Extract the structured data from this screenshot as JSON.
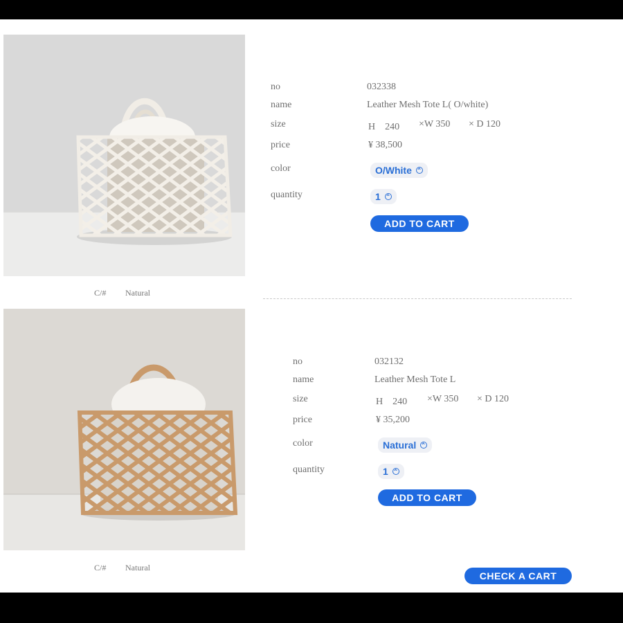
{
  "products": [
    {
      "no_label": "no",
      "no": "032338",
      "name_label": "name",
      "name": "Leather Mesh Tote L( O/white)",
      "size_label": "size",
      "size_h": "H　240",
      "size_w": "×W 350",
      "size_d": "× D 120",
      "price_label": "price",
      "price": "¥ 38,500",
      "color_label": "color",
      "color": "O/White",
      "quantity_label": "quantity",
      "quantity": "1",
      "add_to_cart": "ADD TO CART",
      "caption_code": "C/#",
      "caption_value": "Natural",
      "bag_color": "#f1ede6"
    },
    {
      "no_label": "no",
      "no": "032132",
      "name_label": "name",
      "name": "Leather Mesh Tote L",
      "size_label": "size",
      "size_h": "H　240",
      "size_w": "×W 350",
      "size_d": "× D 120",
      "price_label": "price",
      "price": "¥ 35,200",
      "color_label": "color",
      "color": "Natural",
      "quantity_label": "quantity",
      "quantity": "1",
      "add_to_cart": "ADD TO CART",
      "caption_code": "C/#",
      "caption_value": "Natural",
      "bag_color": "#c99a6b"
    }
  ],
  "check_cart": "CHECK A CART",
  "colors": {
    "accent": "#1f6ae0",
    "accent_text": "#2a6fd6"
  }
}
